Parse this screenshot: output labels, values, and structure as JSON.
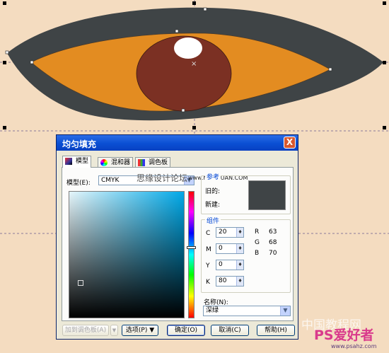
{
  "dialog": {
    "title": "均匀填充",
    "close_label": "X",
    "tabs": [
      {
        "label": "模型"
      },
      {
        "label": "混和器"
      },
      {
        "label": "调色板"
      }
    ],
    "model_label": "模型(E):",
    "model_value": "CMYK",
    "compare": {
      "title": "参考",
      "old_label": "旧的:",
      "new_label": "新建:"
    },
    "components": {
      "title": "组件",
      "c_label": "C",
      "c_value": "20",
      "m_label": "M",
      "m_value": "0",
      "y_label": "Y",
      "y_value": "0",
      "k_label": "K",
      "k_value": "80",
      "r_label": "R",
      "r_value": "63",
      "g_label": "G",
      "g_value": "68",
      "b_label": "B",
      "b_value": "70"
    },
    "name_label": "名称(N):",
    "name_value": "深绿",
    "buttons": {
      "add_palette": "加到调色板(A)",
      "options": "选项(P)",
      "ok": "确定(O)",
      "cancel": "取消(C)",
      "help": "帮助(H)"
    },
    "watermark_forum": "思缘设计论坛",
    "watermark_url": "www.MISSYUAN.COM"
  },
  "footer_watermark": {
    "site_cn": "中国教程网",
    "brand": "PS爱好者",
    "url": "www.psahz.com"
  },
  "colors": {
    "swatch": "#3f4446",
    "background": "#f4dcc0",
    "eye_outline": "#3f4446",
    "iris": "#e38c21",
    "pupil": "#7b3023"
  }
}
